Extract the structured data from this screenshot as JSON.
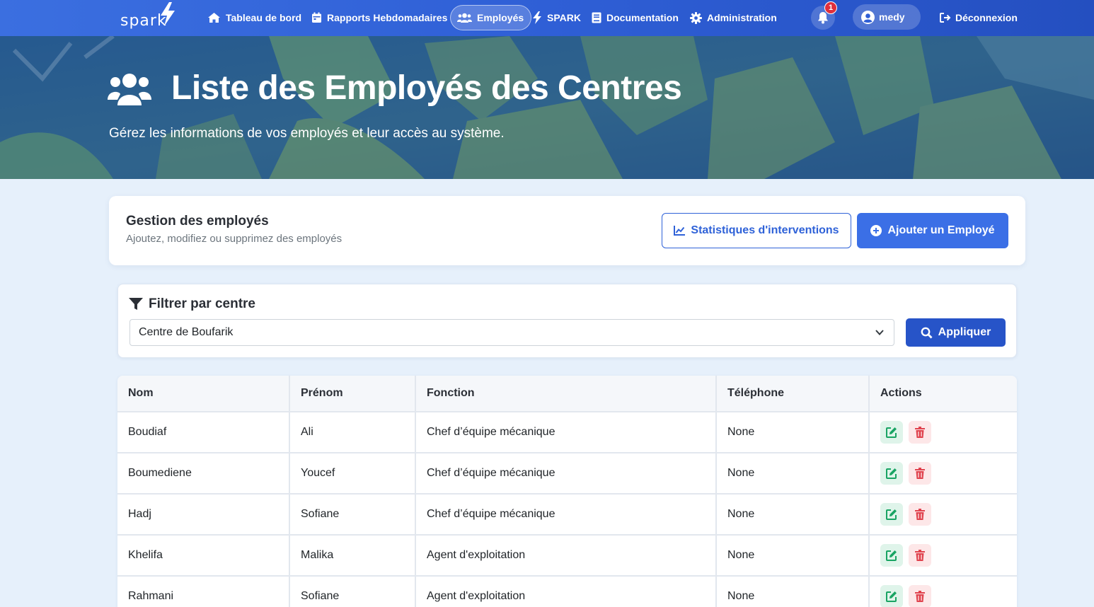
{
  "brand": {
    "logo_text": "spark"
  },
  "nav": {
    "items": [
      {
        "label": "Tableau de bord",
        "icon": "home-icon"
      },
      {
        "label": "Rapports Hebdomadaires",
        "icon": "calendar-icon"
      },
      {
        "label": "Employés",
        "icon": "users-icon",
        "active": true
      },
      {
        "label": "SPARK",
        "icon": "bolt-icon"
      },
      {
        "label": "Documentation",
        "icon": "book-icon"
      },
      {
        "label": "Administration",
        "icon": "gear-icon"
      }
    ],
    "notification_count": "1",
    "user_name": "medy",
    "logout_label": "Déconnexion"
  },
  "hero": {
    "title": "Liste des Employés des Centres",
    "subtitle": "Gérez les informations de vos employés et leur accès au système."
  },
  "management": {
    "title": "Gestion des employés",
    "subtitle": "Ajoutez, modifiez ou supprimez des employés",
    "stats_button": "Statistiques d'interventions",
    "add_button": "Ajouter un Employé"
  },
  "filter": {
    "title": "Filtrer par centre",
    "selected_center": "Centre de Boufarik",
    "apply_button": "Appliquer"
  },
  "table": {
    "headers": [
      "Nom",
      "Prénom",
      "Fonction",
      "Téléphone",
      "Actions"
    ],
    "rows": [
      {
        "nom": "Boudiaf",
        "prenom": "Ali",
        "fonction": "Chef d’équipe mécanique",
        "telephone": "None"
      },
      {
        "nom": "Boumediene",
        "prenom": "Youcef",
        "fonction": "Chef d’équipe mécanique",
        "telephone": "None"
      },
      {
        "nom": "Hadj",
        "prenom": "Sofiane",
        "fonction": "Chef d’équipe mécanique",
        "telephone": "None"
      },
      {
        "nom": "Khelifa",
        "prenom": "Malika",
        "fonction": "Agent d'exploitation",
        "telephone": "None"
      },
      {
        "nom": "Rahmani",
        "prenom": "Sofiane",
        "fonction": "Agent d'exploitation",
        "telephone": "None"
      }
    ]
  },
  "colors": {
    "primary": "#3b6fe6",
    "navbar": "#2f5fd6",
    "apply": "#2754c8",
    "edit": "#19a463",
    "delete": "#e0434e",
    "badge": "#e02f3c"
  }
}
